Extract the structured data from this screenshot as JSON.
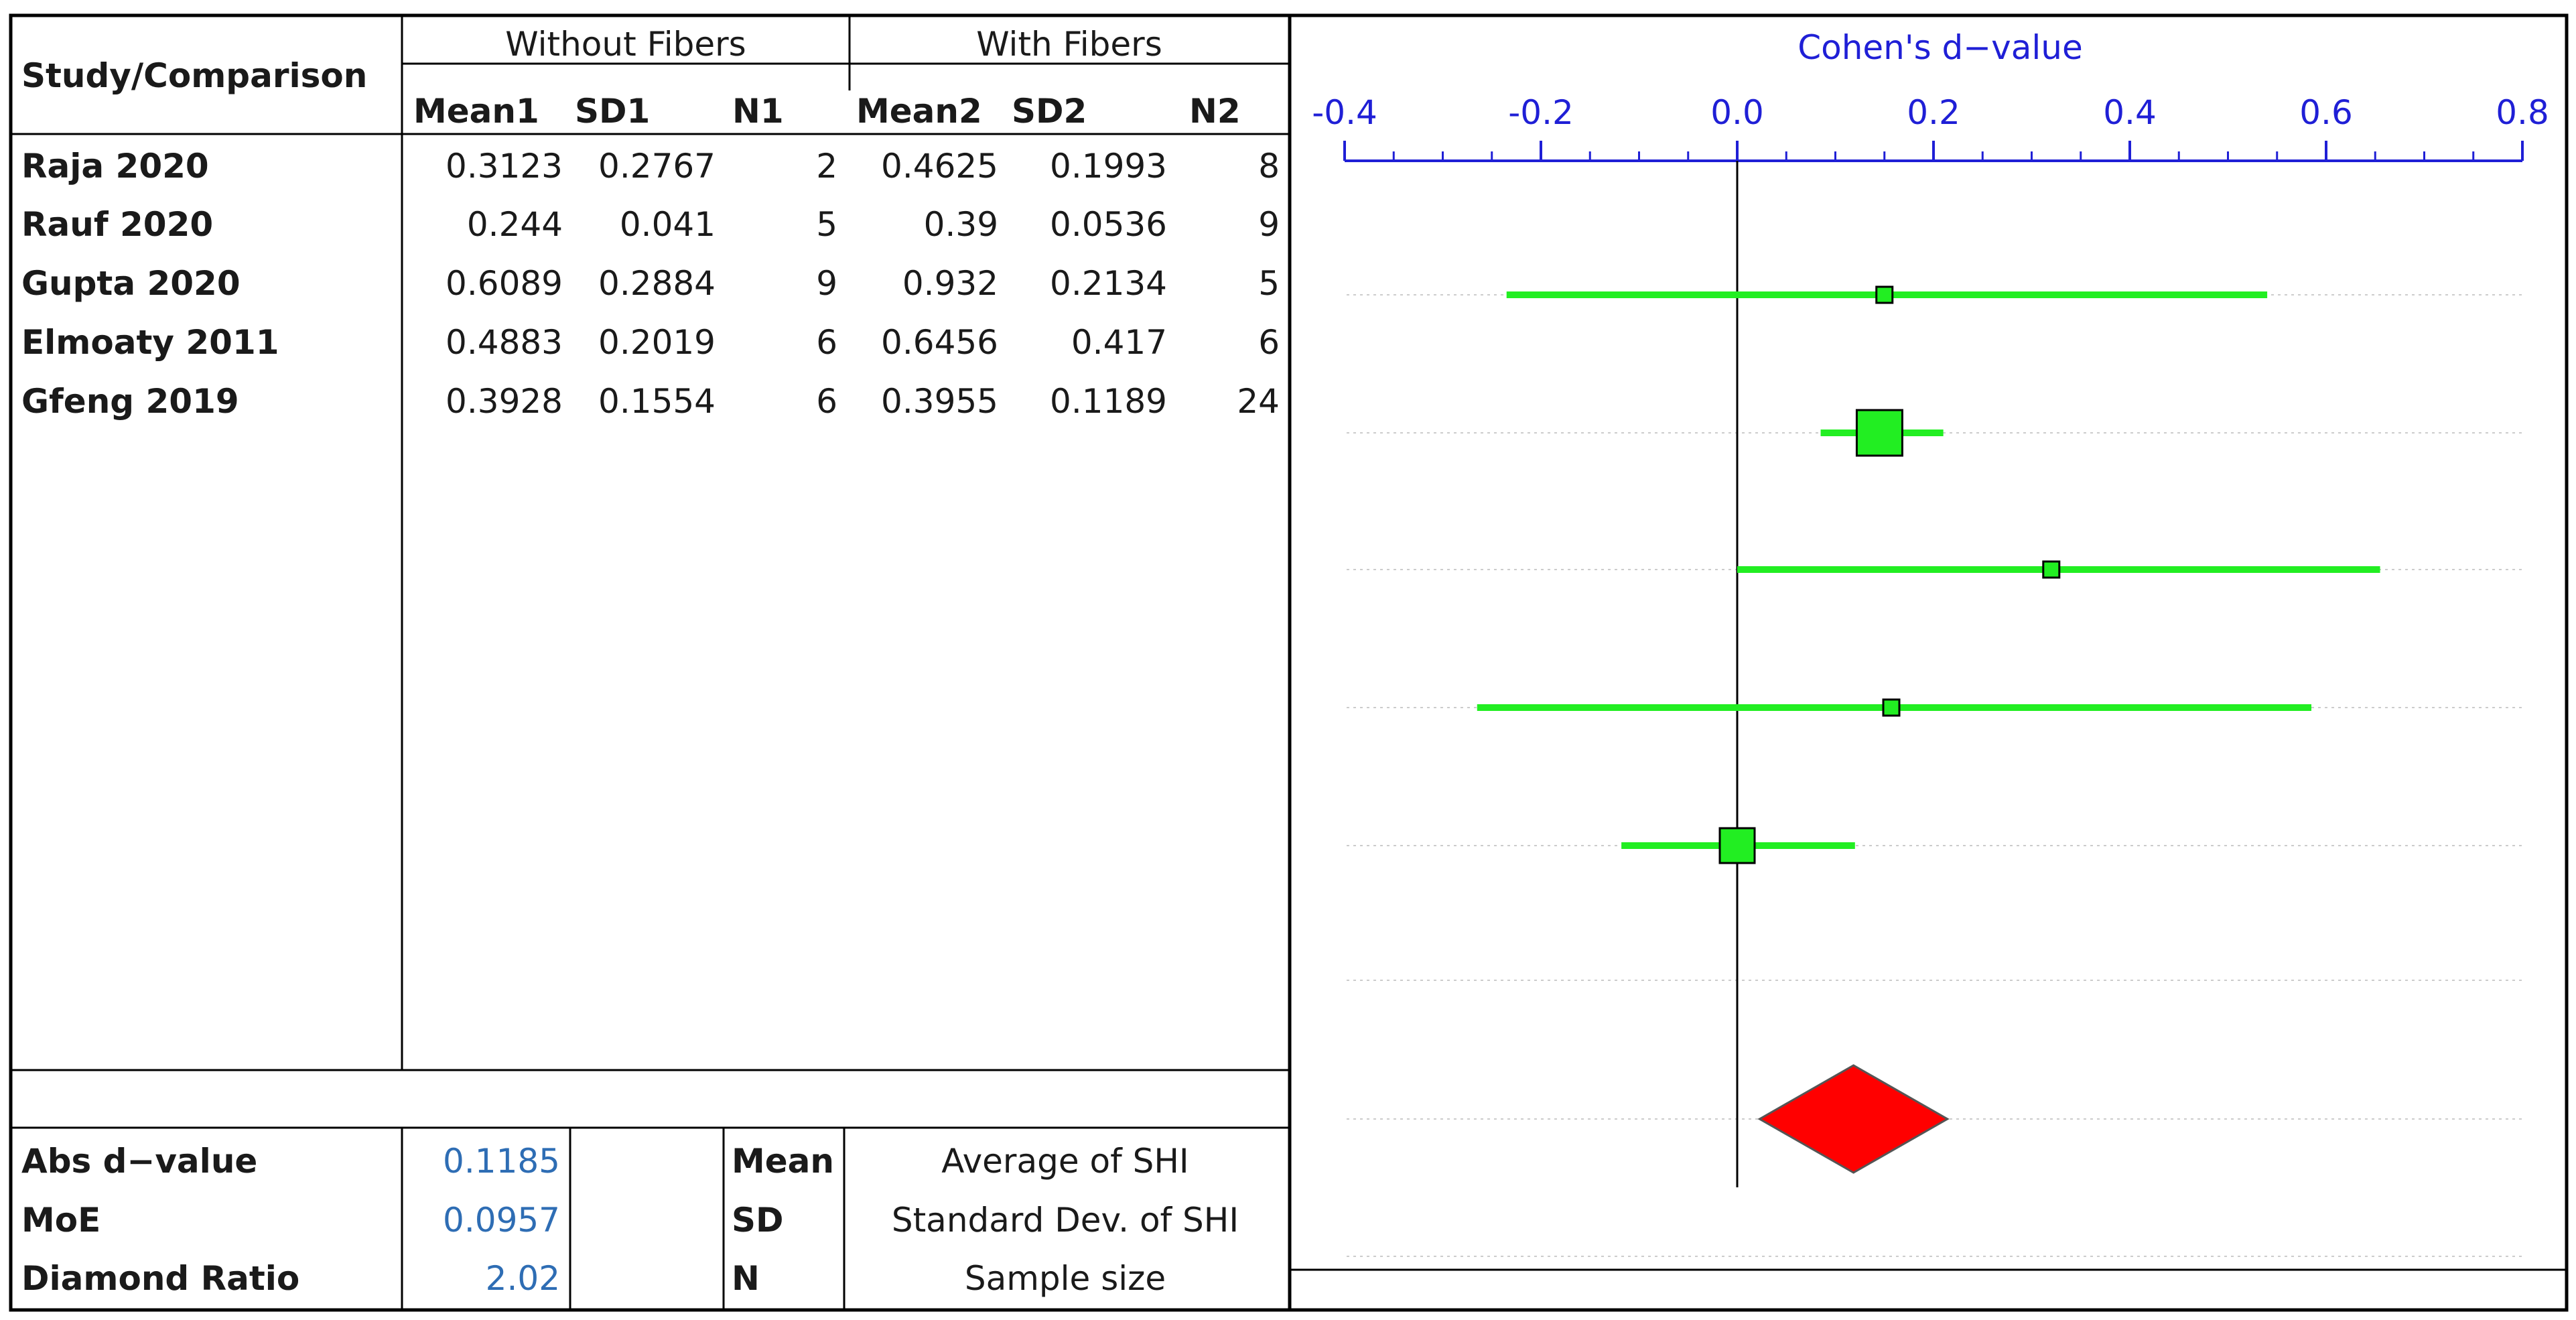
{
  "table": {
    "study_header": "Study/Comparison",
    "group1_header": "Without Fibers",
    "group2_header": "With Fibers",
    "columns": [
      "Mean1",
      "SD1",
      "N1",
      "Mean2",
      "SD2",
      "N2"
    ],
    "rows": [
      {
        "study": "Raja 2020",
        "mean1": "0.3123",
        "sd1": "0.2767",
        "n1": "2",
        "mean2": "0.4625",
        "sd2": "0.1993",
        "n2": "8"
      },
      {
        "study": "Rauf 2020",
        "mean1": "0.244",
        "sd1": "0.041",
        "n1": "5",
        "mean2": "0.39",
        "sd2": "0.0536",
        "n2": "9"
      },
      {
        "study": "Gupta 2020",
        "mean1": "0.6089",
        "sd1": "0.2884",
        "n1": "9",
        "mean2": "0.932",
        "sd2": "0.2134",
        "n2": "5"
      },
      {
        "study": "Elmoaty 2011",
        "mean1": "0.4883",
        "sd1": "0.2019",
        "n1": "6",
        "mean2": "0.6456",
        "sd2": "0.417",
        "n2": "6"
      },
      {
        "study": "Gfeng 2019",
        "mean1": "0.3928",
        "sd1": "0.1554",
        "n1": "6",
        "mean2": "0.3955",
        "sd2": "0.1189",
        "n2": "24"
      }
    ]
  },
  "summary": {
    "rows": [
      {
        "label": "Abs d−value",
        "value": "0.1185"
      },
      {
        "label": "MoE",
        "value": "0.0957"
      },
      {
        "label": "Diamond Ratio",
        "value": "2.02"
      }
    ]
  },
  "legend": {
    "rows": [
      {
        "key": "Mean",
        "desc": "Average of SHI"
      },
      {
        "key": "SD",
        "desc": "Standard Dev. of SHI"
      },
      {
        "key": "N",
        "desc": "Sample size"
      }
    ]
  },
  "chart_data": {
    "type": "forest",
    "title": "Cohen's  d−value",
    "xlim": [
      -0.4,
      0.8
    ],
    "tick_labels": [
      "-0.4",
      "-0.2",
      "0.0",
      "0.2",
      "0.4",
      "0.6",
      "0.8"
    ],
    "tick_values": [
      -0.4,
      -0.2,
      0.0,
      0.2,
      0.4,
      0.6,
      0.8
    ],
    "studies": [
      {
        "study": "Raja 2020",
        "d": 0.15,
        "ci_low": -0.235,
        "ci_high": 0.54,
        "weight": "small"
      },
      {
        "study": "Rauf 2020",
        "d": 0.145,
        "ci_low": 0.085,
        "ci_high": 0.21,
        "weight": "large"
      },
      {
        "study": "Gupta 2020",
        "d": 0.32,
        "ci_low": 0.0,
        "ci_high": 0.655,
        "weight": "small"
      },
      {
        "study": "Elmoaty 2011",
        "d": 0.157,
        "ci_low": -0.265,
        "ci_high": 0.585,
        "weight": "small"
      },
      {
        "study": "Gfeng 2019",
        "d": 0.0,
        "ci_low": -0.118,
        "ci_high": 0.12,
        "weight": "medium"
      }
    ],
    "summary_diamond": {
      "d": 0.1185,
      "ci_low": 0.0228,
      "ci_high": 0.2142
    },
    "colors": {
      "axis": "#1f1fd6",
      "ci": "#22ee22",
      "marker": "#22ee22",
      "diamond": "#ff0000",
      "zero_line": "#000000",
      "grid": "#cccccc"
    }
  }
}
